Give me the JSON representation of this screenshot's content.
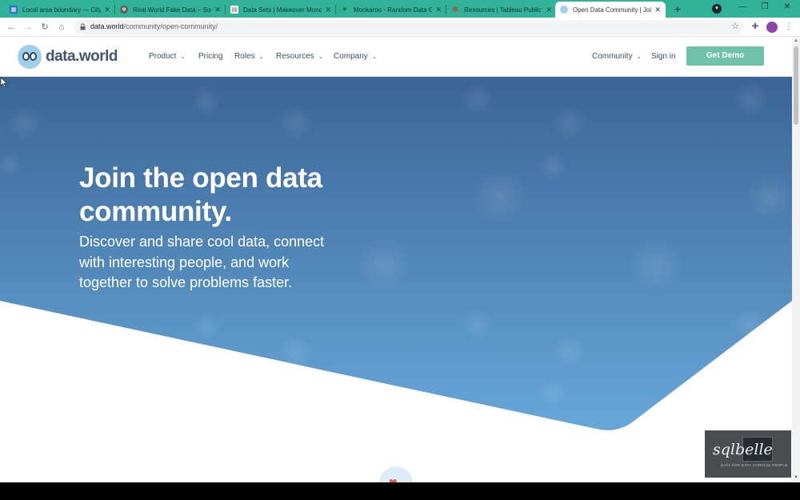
{
  "browser": {
    "tabs": [
      {
        "title": "Local area boundary — City",
        "icon": "map-favicon",
        "color": "#2e6fd8",
        "active": false
      },
      {
        "title": "Real World Fake Data – Som",
        "icon": "tableau-favicon",
        "color": "#5a5a5a",
        "active": false
      },
      {
        "title": "Data Sets | Makeover Mond",
        "icon": "document-favicon",
        "color": "#6b6b6b",
        "active": false
      },
      {
        "title": "Mockaroo - Random Data G",
        "icon": "tree-favicon",
        "color": "#3a9a3a",
        "active": false
      },
      {
        "title": "Resources | Tableau Public",
        "icon": "tableau-favicon",
        "color": "#c0392b",
        "active": false
      },
      {
        "title": "Open Data Community | Joi",
        "icon": "dataworld-favicon",
        "color": "#9fd0ea",
        "active": true
      }
    ],
    "url": {
      "domain": "data.world",
      "path": "/community/open-community/"
    }
  },
  "site": {
    "logo_text": "data.world",
    "nav": [
      {
        "label": "Product",
        "has_menu": true
      },
      {
        "label": "Pricing",
        "has_menu": false
      },
      {
        "label": "Roles",
        "has_menu": true
      },
      {
        "label": "Resources",
        "has_menu": true
      },
      {
        "label": "Company",
        "has_menu": true
      }
    ],
    "right_nav": {
      "community": "Community",
      "sign_in": "Sign in",
      "cta": "Get Demo"
    },
    "cta_color": "#6fc2a9"
  },
  "hero": {
    "title": "Join the open data community.",
    "subtitle": "Discover and share cool data, connect with interesting people, and work together to solve problems faster.",
    "gradient_top": "#3a6596",
    "gradient_bottom": "#67a7d8"
  },
  "overlay": {
    "brand": "sqlbelle",
    "tagline": "DATA FOR DATA CURIOUS PEOPLE"
  }
}
